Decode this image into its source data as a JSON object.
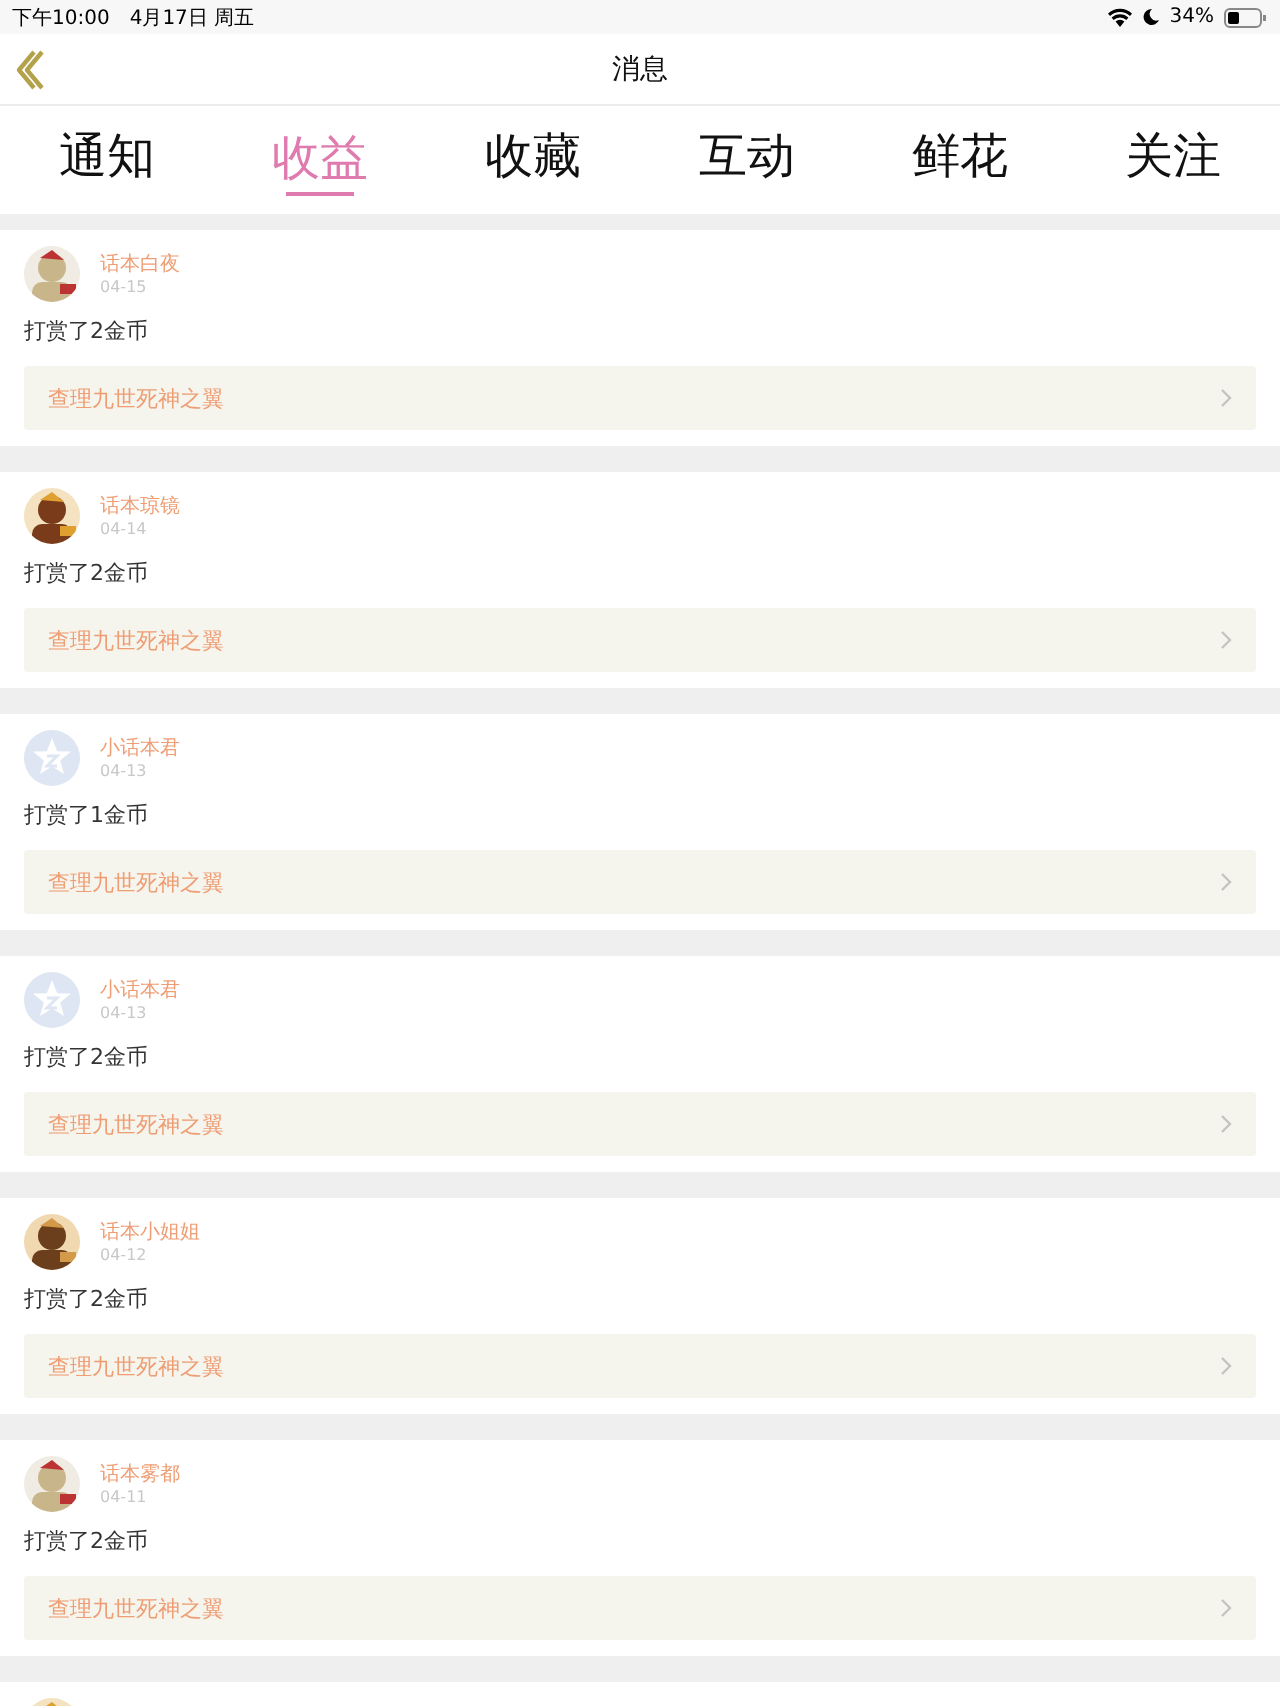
{
  "status_bar": {
    "time": "下午10:00",
    "date": "4月17日 周五",
    "battery": "34%"
  },
  "nav": {
    "title": "消息"
  },
  "tabs": [
    {
      "label": "通知",
      "selected": false
    },
    {
      "label": "收益",
      "selected": true
    },
    {
      "label": "收藏",
      "selected": false
    },
    {
      "label": "互动",
      "selected": false
    },
    {
      "label": "鲜花",
      "selected": false
    },
    {
      "label": "关注",
      "selected": false
    }
  ],
  "messages": [
    {
      "kind": "picture",
      "name": "话本白夜",
      "date": "04-15",
      "text": "打赏了2金币",
      "link": "查理九世死神之翼"
    },
    {
      "kind": "picture",
      "name": "话本琼镜",
      "date": "04-14",
      "text": "打赏了2金币",
      "link": "查理九世死神之翼"
    },
    {
      "kind": "default",
      "name": "小话本君",
      "date": "04-13",
      "text": "打赏了1金币",
      "link": "查理九世死神之翼"
    },
    {
      "kind": "default",
      "name": "小话本君",
      "date": "04-13",
      "text": "打赏了2金币",
      "link": "查理九世死神之翼"
    },
    {
      "kind": "picture",
      "name": "话本小姐姐",
      "date": "04-12",
      "text": "打赏了2金币",
      "link": "查理九世死神之翼"
    },
    {
      "kind": "picture",
      "name": "话本雾都",
      "date": "04-11",
      "text": "打赏了2金币",
      "link": "查理九世死神之翼"
    },
    {
      "kind": "picture"
    }
  ]
}
